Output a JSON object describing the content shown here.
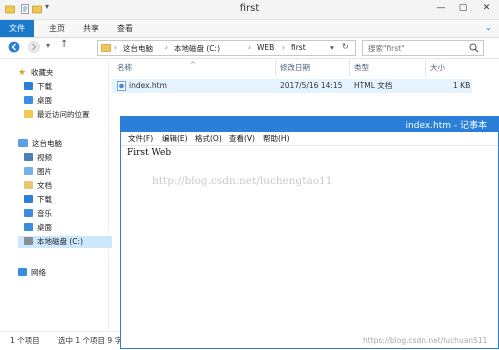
{
  "window": {
    "title": "first",
    "minimize": "—",
    "maximize": "▢",
    "close": "✕"
  },
  "ribbon": {
    "tabs": [
      "文件",
      "主页",
      "共享",
      "查看"
    ]
  },
  "address": {
    "crumbs": [
      "这台电脑",
      "本地磁盘 (C:)",
      "WEB",
      "first"
    ],
    "search_placeholder": "搜索\"first\""
  },
  "nav": {
    "favorites": {
      "label": "收藏夹",
      "items": [
        "下载",
        "桌面",
        "最近访问的位置"
      ]
    },
    "this_pc": {
      "label": "这台电脑",
      "items": [
        "视频",
        "图片",
        "文档",
        "下载",
        "音乐",
        "桌面",
        "本地磁盘 (C:)"
      ],
      "selected": "本地磁盘 (C:)"
    },
    "network": {
      "label": "网络"
    }
  },
  "columns": {
    "name": "名称",
    "date": "修改日期",
    "type": "类型",
    "size": "大小"
  },
  "files": [
    {
      "name": "index.htm",
      "date": "2017/5/16 14:15",
      "type": "HTML 文档",
      "size": "1 KB"
    }
  ],
  "status": {
    "count": "1 个项目",
    "selected": "选中 1 个项目 9 字"
  },
  "notepad": {
    "title": "index.htm - 记事本",
    "menu": [
      "文件(F)",
      "编辑(E)",
      "格式(O)",
      "查看(V)",
      "帮助(H)"
    ],
    "content": "First Web"
  },
  "watermarks": {
    "center": "http://blog.csdn.net/luchengtao11",
    "corner": "https://blog.csdn.net/luchuan511"
  }
}
